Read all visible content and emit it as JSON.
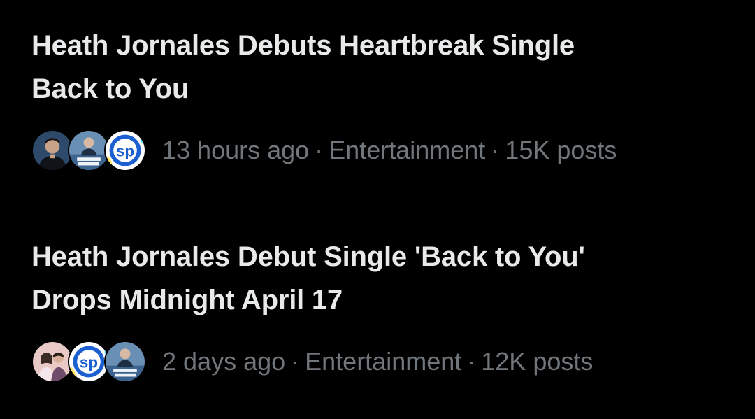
{
  "stories": [
    {
      "headline_line1": "Heath Jornales Debuts Heartbreak Single",
      "headline_line2": "Back to You",
      "time": "13 hours ago",
      "category": "Entertainment",
      "posts": "15K posts",
      "avatars": [
        "person-portrait-avatar",
        "heath-wavers-fan-avatar",
        "sp-logo-avatar"
      ]
    },
    {
      "headline_line1": "Heath Jornales Debut Single 'Back to You'",
      "headline_line2": "Drops Midnight April 17",
      "time": "2 days ago",
      "category": "Entertainment",
      "posts": "12K posts",
      "avatars": [
        "couple-photo-avatar",
        "sp-logo-avatar",
        "heath-wavers-fan-avatar"
      ]
    }
  ],
  "separator": "·",
  "colors": {
    "background": "#000000",
    "headline": "#e7e9ea",
    "meta": "#71767b"
  }
}
